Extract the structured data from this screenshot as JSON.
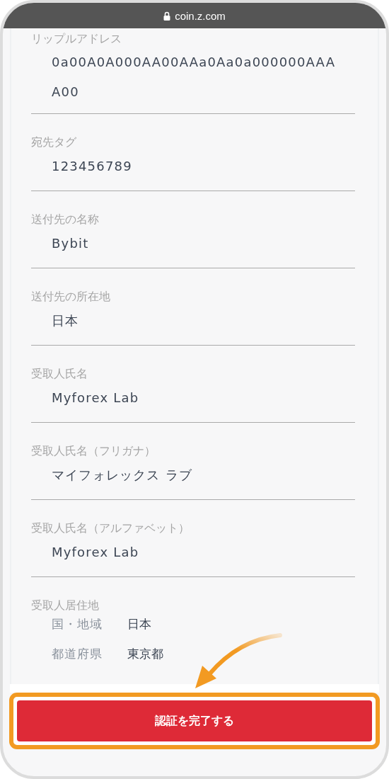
{
  "browser": {
    "url": "coin.z.com"
  },
  "fields": [
    {
      "label": "リップルアドレス",
      "value_lines": [
        "0a00A0A000AA00AAa0Aa0a000000AAA",
        "A00"
      ]
    },
    {
      "label": "宛先タグ",
      "value_lines": [
        "123456789"
      ]
    },
    {
      "label": "送付先の名称",
      "value_lines": [
        "Bybit"
      ]
    },
    {
      "label": "送付先の所在地",
      "value_lines": [
        "日本"
      ]
    },
    {
      "label": "受取人氏名",
      "value_lines": [
        "Myforex Lab"
      ]
    },
    {
      "label": "受取人氏名（フリガナ）",
      "value_lines": [
        "マイフォレックス ラブ"
      ]
    },
    {
      "label": "受取人氏名（アルファベット）",
      "value_lines": [
        "Myforex Lab"
      ]
    },
    {
      "label": "受取人居住地",
      "rows": [
        {
          "key": "国・地域",
          "value": "日本"
        },
        {
          "key": "都道府県",
          "value": "東京都"
        }
      ]
    }
  ],
  "submit_button": {
    "label": "認証を完了する"
  }
}
